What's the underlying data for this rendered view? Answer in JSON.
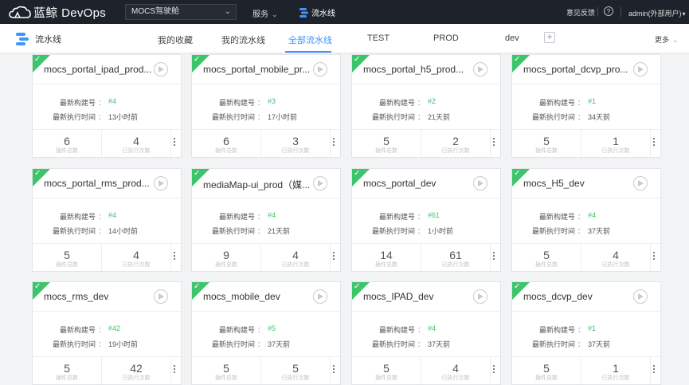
{
  "header": {
    "brand": "蓝鲸 DevOps",
    "project": "MOCS驾驶舱",
    "service_label": "服务",
    "pipeline_label": "流水线",
    "feedback": "意见反馈",
    "help_glyph": "?",
    "user": "admin(外部用户)"
  },
  "subnav": {
    "title": "流水线",
    "tabs": [
      {
        "label": "我的收藏"
      },
      {
        "label": "我的流水线"
      },
      {
        "label": "全部流水线",
        "active": true
      },
      {
        "label": "TEST"
      },
      {
        "label": "PROD"
      },
      {
        "label": "dev"
      }
    ],
    "add_glyph": "+",
    "more_label": "更多"
  },
  "card_labels": {
    "latest_build": "最新构建号",
    "latest_exec": "最新执行时间",
    "colon": "：",
    "plugins_total": "插件总数",
    "executed_count": "已执行次数"
  },
  "pipelines": [
    {
      "name": "mocs_portal_ipad_prod...",
      "build": "#4",
      "time": "13小时前",
      "plugins": "6",
      "executions": "4"
    },
    {
      "name": "mocs_portal_mobile_pr...",
      "build": "#3",
      "time": "17小时前",
      "plugins": "6",
      "executions": "3"
    },
    {
      "name": "mocs_portal_h5_prod...",
      "build": "#2",
      "time": "21天前",
      "plugins": "5",
      "executions": "2"
    },
    {
      "name": "mocs_portal_dcvp_pro...",
      "build": "#1",
      "time": "34天前",
      "plugins": "5",
      "executions": "1"
    },
    {
      "name": "mocs_portal_rms_prod...",
      "build": "#4",
      "time": "14小时前",
      "plugins": "5",
      "executions": "4"
    },
    {
      "name": "mediaMap-ui_prod（媒...",
      "build": "#4",
      "time": "21天前",
      "plugins": "9",
      "executions": "4"
    },
    {
      "name": "mocs_portal_dev",
      "build": "#61",
      "time": "1小时前",
      "plugins": "14",
      "executions": "61"
    },
    {
      "name": "mocs_H5_dev",
      "build": "#4",
      "time": "37天前",
      "plugins": "5",
      "executions": "4"
    },
    {
      "name": "mocs_rms_dev",
      "build": "#42",
      "time": "19小时前",
      "plugins": "5",
      "executions": "42"
    },
    {
      "name": "mocs_mobile_dev",
      "build": "#5",
      "time": "37天前",
      "plugins": "5",
      "executions": "5"
    },
    {
      "name": "mocs_IPAD_dev",
      "build": "#4",
      "time": "37天前",
      "plugins": "5",
      "executions": "4"
    },
    {
      "name": "mocs_dcvp_dev",
      "build": "#1",
      "time": "37天前",
      "plugins": "5",
      "executions": "1"
    }
  ],
  "colors": {
    "accent": "#3c96ff",
    "success": "#3ec56c",
    "topbar": "#1e222a"
  }
}
